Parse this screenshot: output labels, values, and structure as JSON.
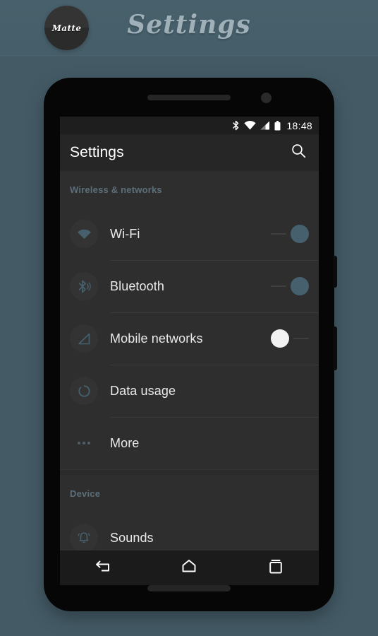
{
  "header": {
    "brand_label": "Matte",
    "title": "Settings"
  },
  "phone": {
    "statusbar": {
      "bluetooth_icon": "bluetooth-icon",
      "wifi_icon": "wifi-icon",
      "signal_icon": "signal-icon",
      "battery_icon": "battery-icon",
      "time": "18:48"
    },
    "appbar": {
      "title": "Settings",
      "search_icon": "search-icon"
    },
    "sections": [
      {
        "header": "Wireless & networks",
        "rows": [
          {
            "icon": "wifi-icon",
            "label": "Wi-Fi",
            "control": "toggle",
            "state": "on"
          },
          {
            "icon": "bluetooth-icon",
            "label": "Bluetooth",
            "control": "toggle",
            "state": "on"
          },
          {
            "icon": "signal-icon",
            "label": "Mobile networks",
            "control": "toggle",
            "state": "off"
          },
          {
            "icon": "data-usage-icon",
            "label": "Data usage",
            "control": "none",
            "state": ""
          },
          {
            "icon": "more-icon",
            "label": "More",
            "control": "none",
            "state": ""
          }
        ]
      },
      {
        "header": "Device",
        "rows": [
          {
            "icon": "bell-icon",
            "label": "Sounds",
            "control": "none",
            "state": ""
          }
        ]
      }
    ],
    "navbar": {
      "back_icon": "back-icon",
      "home_icon": "home-icon",
      "recents_icon": "recents-icon"
    }
  },
  "colors": {
    "page_background": "#445b66",
    "screen_background": "#2e2e2e",
    "accent": "#46616d",
    "section_header_text": "#5c6e79",
    "row_label_text": "#eaeaea"
  }
}
